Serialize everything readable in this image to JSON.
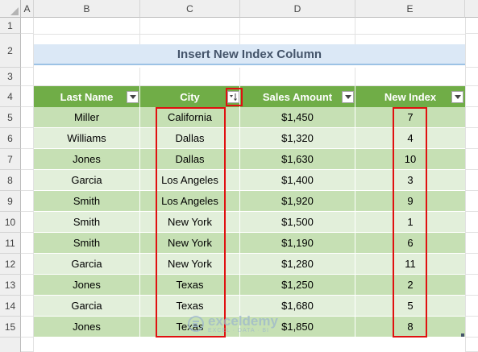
{
  "columns": [
    "A",
    "B",
    "C",
    "D",
    "E"
  ],
  "rows": [
    "1",
    "2",
    "3",
    "4",
    "5",
    "6",
    "7",
    "8",
    "9",
    "10",
    "11",
    "12",
    "13",
    "14",
    "15"
  ],
  "title": "Insert New Index Column",
  "table": {
    "headers": [
      "Last Name",
      "City",
      "Sales Amount",
      "New Index"
    ],
    "rows": [
      [
        "Miller",
        "California",
        "$1,450",
        "7"
      ],
      [
        "Williams",
        "Dallas",
        "$1,320",
        "4"
      ],
      [
        "Jones",
        "Dallas",
        "$1,630",
        "10"
      ],
      [
        "Garcia",
        "Los Angeles",
        "$1,400",
        "3"
      ],
      [
        "Smith",
        "Los Angeles",
        "$1,920",
        "9"
      ],
      [
        "Smith",
        "New York",
        "$1,500",
        "1"
      ],
      [
        "Smith",
        "New York",
        "$1,190",
        "6"
      ],
      [
        "Garcia",
        "New York",
        "$1,280",
        "11"
      ],
      [
        "Jones",
        "Texas",
        "$1,250",
        "2"
      ],
      [
        "Garcia",
        "Texas",
        "$1,680",
        "5"
      ],
      [
        "Jones",
        "Texas",
        "$1,850",
        "8"
      ]
    ]
  },
  "filter_icons": [
    "dropdown-arrow-icon",
    "sort-filter-icon",
    "dropdown-arrow-icon",
    "dropdown-arrow-icon"
  ],
  "highlight_color": "#e01010",
  "header_color": "#70ad47",
  "watermark": {
    "brand": "exceldemy",
    "tagline": "EXCEL · DATA · BI"
  }
}
